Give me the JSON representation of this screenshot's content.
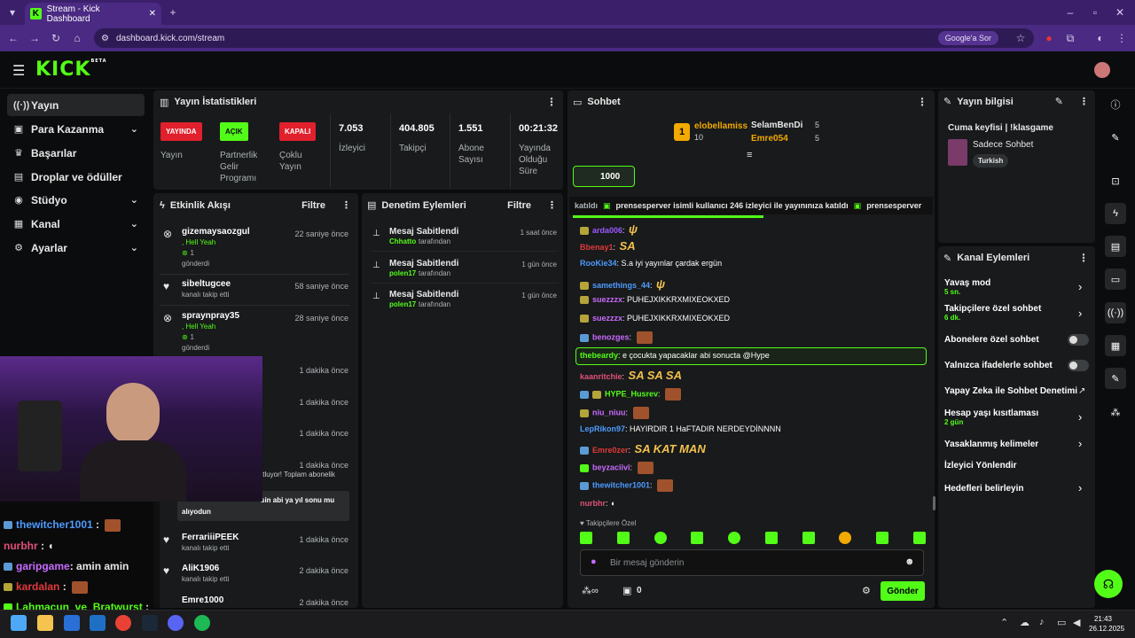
{
  "browser": {
    "tab_title": "Stream - Kick Dashboard",
    "url": "dashboard.kick.com/stream",
    "google_btn": "Google'a Sor"
  },
  "header": {
    "logo": "KICK",
    "beta": "BETA"
  },
  "sidebar": {
    "items": [
      {
        "label": "Yayın"
      },
      {
        "label": "Para Kazanma"
      },
      {
        "label": "Başarılar"
      },
      {
        "label": "Droplar ve ödüller"
      },
      {
        "label": "Stüdyo"
      },
      {
        "label": "Kanal"
      },
      {
        "label": "Ayarlar"
      }
    ]
  },
  "stats": {
    "title": "Yayın İstatistikleri",
    "badges": {
      "live": "YAYINDA",
      "open": "AÇIK",
      "closed": "KAPALI"
    },
    "labels": {
      "live": "Yayın",
      "partner": "Partnerlik Gelir Programı",
      "multi": "Çoklu Yayın",
      "viewers": "İzleyici",
      "followers": "Takipçi",
      "subs": "Abone Sayısı",
      "duration": "Yayında Olduğu Süre"
    },
    "values": {
      "viewers": "7.053",
      "followers": "404.805",
      "subs": "1.551",
      "duration": "00:21:32"
    }
  },
  "activity": {
    "title": "Etkinlik Akışı",
    "filter": "Filtre",
    "items": [
      {
        "name": "gizemaysaozgul",
        "line1": ", Hell Yeah",
        "count": "1",
        "line2": "gönderdi",
        "time": "22 saniye önce"
      },
      {
        "name": "sibeltugcee",
        "line1": "kanalı takip etti",
        "time": "58 saniye önce"
      },
      {
        "name": "spraynpray35",
        "line1": ", Hell Yeah",
        "count": "1",
        "line2": "gönderdi",
        "time": "28 saniye önce"
      },
      {
        "time": "1 dakika önce"
      },
      {
        "time": "1 dakika önce"
      },
      {
        "time": "1 dakika önce"
      },
      {
        "time": "1 dakika önce"
      },
      {
        "name": "FerrariiiPEEK",
        "line1": "kanalı takip etti",
        "time": "1 dakika önce"
      },
      {
        "name": "AliK1906",
        "line1": "kanalı takip etti",
        "time": "2 dakika önce"
      },
      {
        "name": "Emre1000",
        "time": "2 dakika önce"
      }
    ],
    "partial1": "ttluyor! Toplam abonelik",
    "partial2": "sin abi ya yıl sonu mu",
    "partial3": "alıyodun"
  },
  "moderation": {
    "title": "Denetim Eylemleri",
    "filter": "Filtre",
    "items": [
      {
        "action": "Mesaj Sabitlendi",
        "user": "Chhatto",
        "by": "tarafından",
        "time": "1 saat önce"
      },
      {
        "action": "Mesaj Sabitlendi",
        "user": "polen17",
        "by": "tarafından",
        "time": "1 gün önce"
      },
      {
        "action": "Mesaj Sabitlendi",
        "user": "polen17",
        "by": "tarafından",
        "time": "1 gün önce"
      }
    ]
  },
  "chat": {
    "title": "Sohbet",
    "leaders": [
      {
        "name": "elobellamiss",
        "count": "10",
        "rank": "1"
      },
      {
        "name": "SelamBenDi",
        "count": "5"
      },
      {
        "name": "Emre054",
        "count": "5"
      }
    ],
    "pinned_count": "1000",
    "ticker": "prensesperver isimli kullanıcı 246 izleyici ile yayınınıza katıldı",
    "ticker_pre": "katıldı",
    "ticker_post": "prensesperver",
    "messages": [
      {
        "user": "arda006",
        "color": "#9b59ff",
        "text": ""
      },
      {
        "user": "Bbenay1",
        "color": "#e03a3a",
        "text": "SA"
      },
      {
        "user": "RooKie34",
        "color": "#4e9bff",
        "text": ": S.a iyi yayınlar çardak ergün"
      },
      {
        "user": "samethings_44",
        "color": "#4e9bff",
        "text": ""
      },
      {
        "user": "suezzzx",
        "color": "#c86bff",
        "text": ": PUHEJXIKKRXMIXEOKXED"
      },
      {
        "user": "suezzzx",
        "color": "#c86bff",
        "text": ": PUHEJXIKKRXMIXEOKXED"
      },
      {
        "user": "benozges",
        "color": "#c86bff",
        "text": ""
      },
      {
        "user": "thebeardy",
        "color": "#53fc18",
        "text": ": e çocukta yapacaklar abi sonucta @Hype"
      },
      {
        "user": "kaanritchie",
        "color": "#e0507a",
        "text": "SA SA SA"
      },
      {
        "user": "HYPE_Husrev",
        "color": "#53fc18",
        "text": ""
      },
      {
        "user": "niu_niuu",
        "color": "#c86bff",
        "text": ""
      },
      {
        "user": "LepRikon97",
        "color": "#4e9bff",
        "text": ": HAYIRDIR 1 HaFTADIR NERDEYDİNNNN"
      },
      {
        "user": "Emre0zer",
        "color": "#e03a3a",
        "text": "SA KAT MAN"
      },
      {
        "user": "beyzaciivi",
        "color": "#c86bff",
        "text": ""
      },
      {
        "user": "thewitcher1001",
        "color": "#4e9bff",
        "text": ""
      },
      {
        "user": "nurbhr",
        "color": "#e0507a",
        "text": ""
      }
    ],
    "followers_only": "Takipçilere Özel",
    "placeholder": "Bir mesaj gönderin",
    "send": "Gönder",
    "points": "0"
  },
  "info": {
    "title": "Yayın bilgisi",
    "stream_title": "Cuma keyfisi | !klasgame",
    "category": "Sadece Sohbet",
    "tag": "Turkish"
  },
  "actions": {
    "title": "Kanal Eylemleri",
    "items": [
      {
        "label": "Yavaş mod",
        "sub": "5 sn."
      },
      {
        "label": "Takipçilere özel sohbet",
        "sub": "6 dk."
      },
      {
        "label": "Abonelere özel sohbet"
      },
      {
        "label": "Yalnızca ifadelerle sohbet"
      },
      {
        "label": "Yapay Zeka ile Sohbet Denetimi"
      },
      {
        "label": "Hesap yaşı kısıtlaması",
        "sub": "2 gün"
      },
      {
        "label": "Yasaklanmış kelimeler"
      },
      {
        "label": "İzleyici Yönlendir"
      },
      {
        "label": "Hedefleri belirleyin"
      }
    ]
  },
  "overlay": {
    "users": [
      {
        "name": "thewitcher1001",
        "color": "#4e9bff"
      },
      {
        "name": "nurbhr",
        "color": "#e0507a"
      },
      {
        "name": "garipgame",
        "color": "#c86bff",
        "text": ": amin amin"
      },
      {
        "name": "kardalan",
        "color": "#e03a3a"
      },
      {
        "name": "Lahmacun_ve_Bratwurst",
        "color": "#53fc18"
      }
    ]
  },
  "taskbar": {
    "time": "21:43",
    "date": "26.12.2025"
  },
  "colors": {
    "accent": "#53fc18",
    "live": "#e0202c",
    "browser": "#3b1f6b"
  }
}
